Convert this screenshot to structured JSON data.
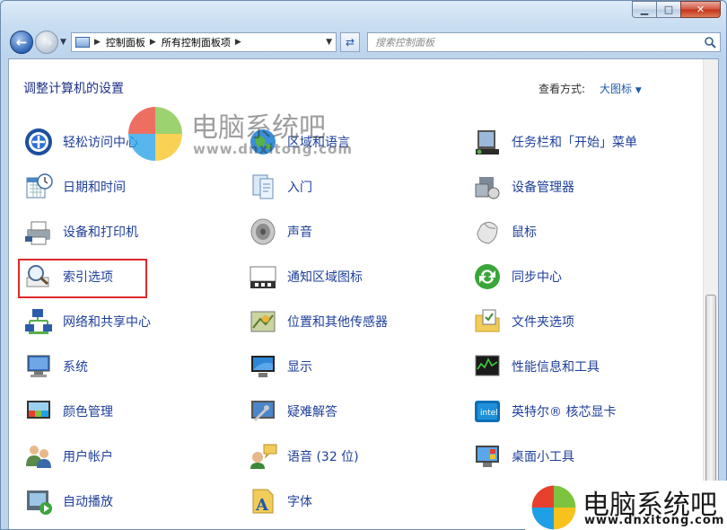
{
  "window": {
    "caption": {
      "minimize": "▁",
      "maximize": "□",
      "close": "✕"
    }
  },
  "navbar": {
    "back_icon": "back-arrow-icon",
    "forward_icon": "forward-arrow-icon",
    "breadcrumbs": [
      "控制面板",
      "所有控制面板项"
    ],
    "search_placeholder": "搜索控制面板"
  },
  "content": {
    "heading": "调整计算机的设置",
    "view_by_label": "查看方式:",
    "view_by_value": "大图标",
    "items": [
      {
        "label": "轻松访问中心",
        "icon": "ease-of-access-icon"
      },
      {
        "label": "区域和语言",
        "icon": "globe-icon"
      },
      {
        "label": "任务栏和「开始」菜单",
        "icon": "taskbar-icon"
      },
      {
        "label": "日期和时间",
        "icon": "calendar-clock-icon"
      },
      {
        "label": "入门",
        "icon": "getting-started-icon"
      },
      {
        "label": "设备管理器",
        "icon": "device-manager-icon"
      },
      {
        "label": "设备和打印机",
        "icon": "printer-icon"
      },
      {
        "label": "声音",
        "icon": "speaker-icon"
      },
      {
        "label": "鼠标",
        "icon": "mouse-icon"
      },
      {
        "label": "索引选项",
        "icon": "index-search-icon"
      },
      {
        "label": "通知区域图标",
        "icon": "notification-area-icon"
      },
      {
        "label": "同步中心",
        "icon": "sync-icon"
      },
      {
        "label": "网络和共享中心",
        "icon": "network-icon"
      },
      {
        "label": "位置和其他传感器",
        "icon": "location-sensor-icon"
      },
      {
        "label": "文件夹选项",
        "icon": "folder-options-icon"
      },
      {
        "label": "系统",
        "icon": "system-icon"
      },
      {
        "label": "显示",
        "icon": "display-icon"
      },
      {
        "label": "性能信息和工具",
        "icon": "performance-icon"
      },
      {
        "label": "颜色管理",
        "icon": "color-management-icon"
      },
      {
        "label": "疑难解答",
        "icon": "troubleshooting-icon"
      },
      {
        "label": "英特尔® 核芯显卡",
        "icon": "intel-graphics-icon"
      },
      {
        "label": "用户帐户",
        "icon": "user-accounts-icon"
      },
      {
        "label": "语音 (32 位)",
        "icon": "speech-icon"
      },
      {
        "label": "桌面小工具",
        "icon": "desktop-gadgets-icon"
      },
      {
        "label": "自动播放",
        "icon": "autoplay-icon"
      },
      {
        "label": "字体",
        "icon": "fonts-icon"
      }
    ]
  },
  "watermark": {
    "brand": "电脑系统吧",
    "url_top": "www.dnxitong.com",
    "url_bottom": "www.dnxitong.com"
  },
  "colors": {
    "link": "#1e3f9a",
    "heading": "#1e3287",
    "highlight": "#e0292a"
  }
}
